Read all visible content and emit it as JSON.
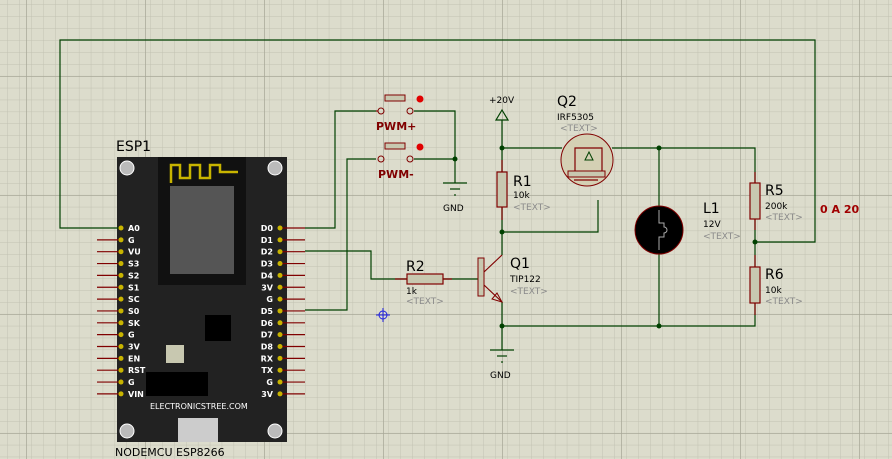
{
  "esp": {
    "ref": "ESP1",
    "part": "NODEMCU ESP8266",
    "brand": "ELECTRONICSTREE.COM",
    "left_pins": [
      "A0",
      "G",
      "VU",
      "S3",
      "S2",
      "S1",
      "SC",
      "S0",
      "SK",
      "G",
      "3V",
      "EN",
      "RST",
      "G",
      "VIN"
    ],
    "right_pins": [
      "D0",
      "D1",
      "D2",
      "D3",
      "D4",
      "3V",
      "G",
      "D5",
      "D6",
      "D7",
      "D8",
      "RX",
      "TX",
      "G",
      "3V"
    ]
  },
  "switches": [
    {
      "label": "PWM+"
    },
    {
      "label": "PWM-"
    }
  ],
  "gnd": [
    "GND",
    "GND"
  ],
  "supply": "+20V",
  "components": {
    "r1": {
      "ref": "R1",
      "value": "10k",
      "text": "<TEXT>"
    },
    "r2": {
      "ref": "R2",
      "value": "1k",
      "text": "<TEXT>"
    },
    "r5": {
      "ref": "R5",
      "value": "200k",
      "text": "<TEXT>"
    },
    "r6": {
      "ref": "R6",
      "value": "10k",
      "text": "<TEXT>"
    },
    "q1": {
      "ref": "Q1",
      "value": "TIP122",
      "text": "<TEXT>"
    },
    "q2": {
      "ref": "Q2",
      "value": "IRF5305",
      "text": "<TEXT>"
    },
    "l1": {
      "ref": "L1",
      "value": "12V",
      "text": "<TEXT>"
    }
  },
  "probe_readout": "0 A 20",
  "colors": {
    "wire": "#004000",
    "pin": "#800000",
    "grid_bg": "#dcdccc",
    "probe": "#a00000",
    "board": "#222222"
  }
}
